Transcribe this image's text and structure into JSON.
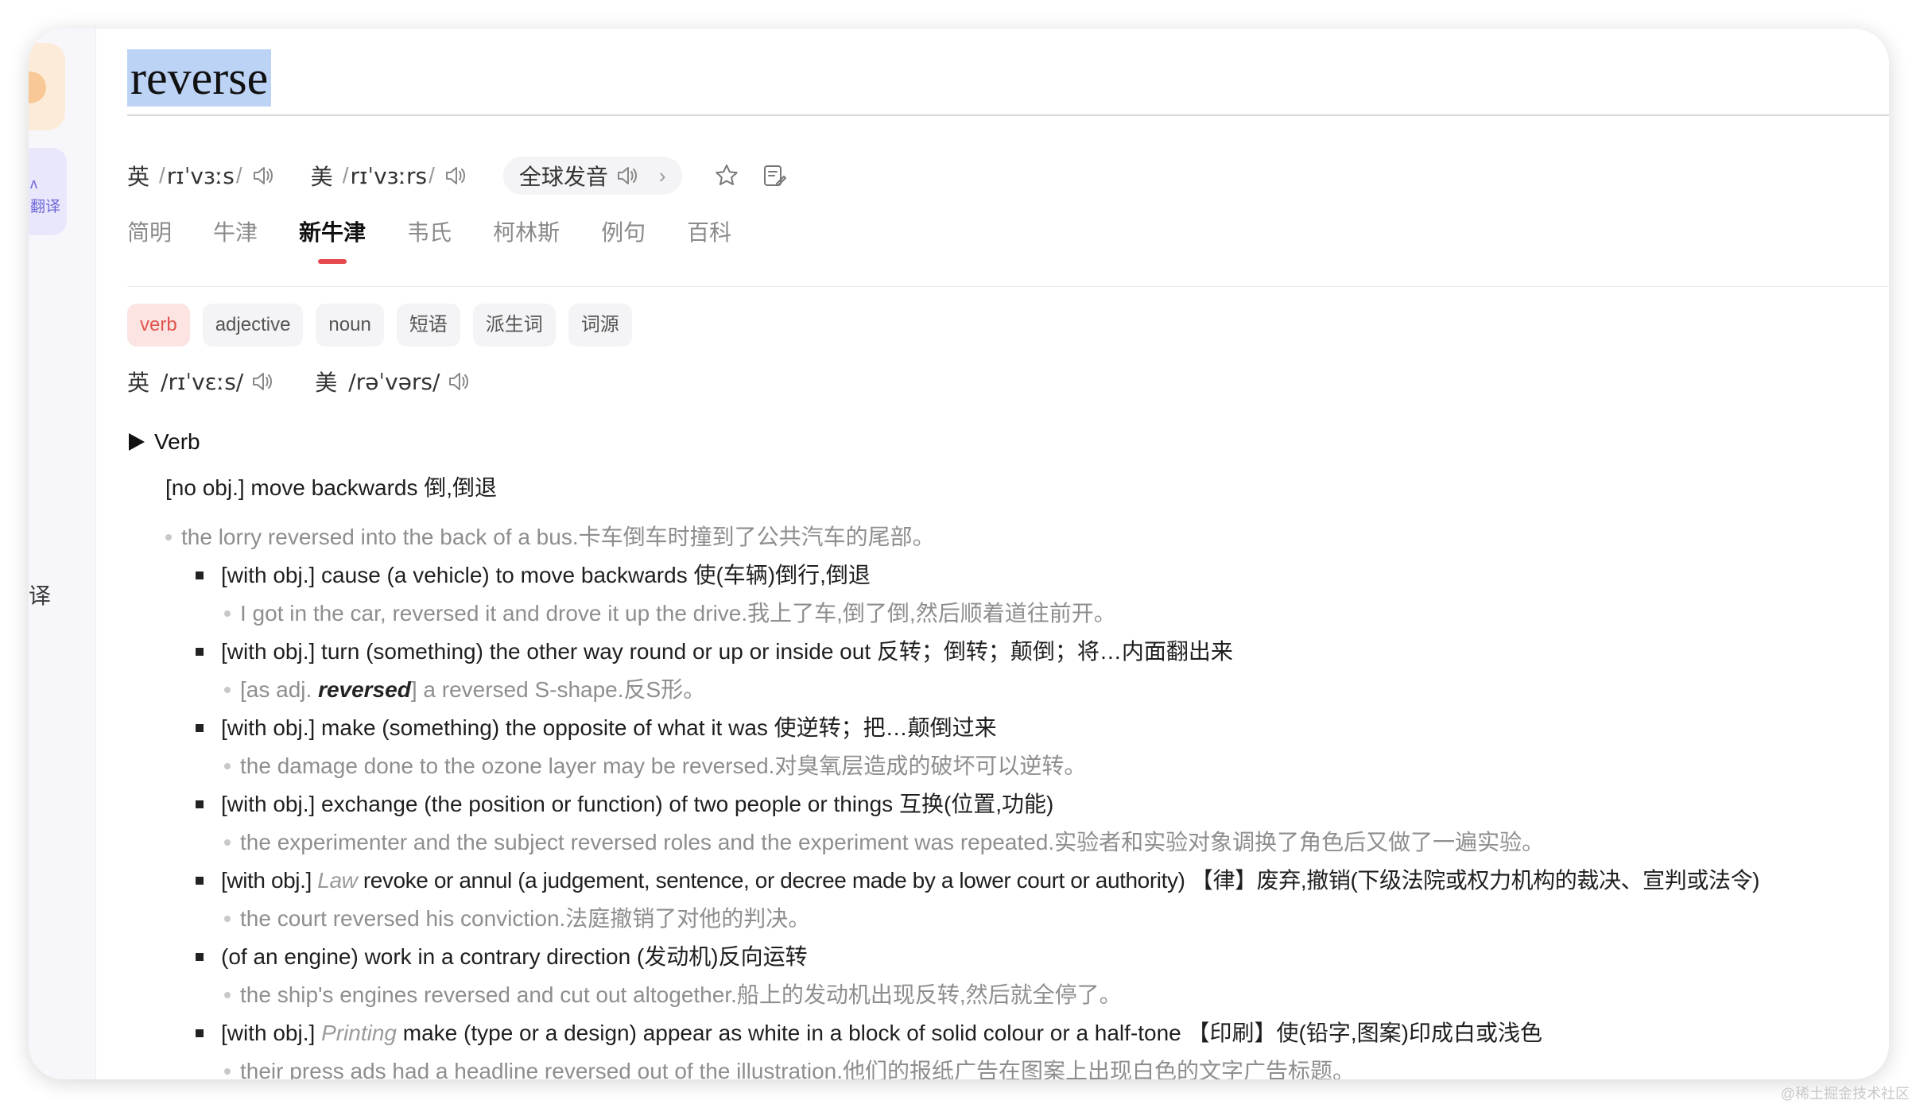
{
  "sidebar": {
    "translate_label_line1": "ʌ",
    "translate_label_line2": "翻译",
    "side_text": "译"
  },
  "word": "reverse",
  "pronunciations": [
    {
      "region": "英",
      "ipa": "rɪˈvɜːs"
    },
    {
      "region": "美",
      "ipa": "rɪˈvɜːrs"
    }
  ],
  "global_pron": {
    "label": "全球发音",
    "chevron": "›"
  },
  "icons": {
    "speaker": "speaker-icon",
    "star": "star-icon",
    "note": "note-edit-icon"
  },
  "tabs": [
    {
      "label": "简明",
      "active": false
    },
    {
      "label": "牛津",
      "active": false
    },
    {
      "label": "新牛津",
      "active": true
    },
    {
      "label": "韦氏",
      "active": false
    },
    {
      "label": "柯林斯",
      "active": false
    },
    {
      "label": "例句",
      "active": false
    },
    {
      "label": "百科",
      "active": false
    }
  ],
  "pos_filters": [
    {
      "label": "verb",
      "active": true
    },
    {
      "label": "adjective",
      "active": false
    },
    {
      "label": "noun",
      "active": false
    },
    {
      "label": "短语",
      "active": false
    },
    {
      "label": "派生词",
      "active": false
    },
    {
      "label": "词源",
      "active": false
    }
  ],
  "pron2": [
    {
      "region": "英",
      "ipa": "/rɪˈvɛːs/"
    },
    {
      "region": "美",
      "ipa": "/rəˈvərs/"
    }
  ],
  "section": "Verb",
  "first_sense": {
    "def": "[no obj.] move backwards 倒,倒退",
    "example": "the lorry reversed into the back of a bus.卡车倒车时撞到了公共汽车的尾部。"
  },
  "senses": [
    {
      "pre": "[with obj.] cause (a vehicle) to move backwards 使(车辆)倒行,倒退",
      "example": "I got in the car, reversed it and drove it up the drive.我上了车,倒了倒,然后顺着道往前开。"
    },
    {
      "pre": "[with obj.] turn (something) the other way round or up or inside out 反转；倒转；颠倒；将…内面翻出来",
      "example_pre": "[as adj. ",
      "example_bold": "reversed",
      "example_post": "] a reversed S-shape.反S形。"
    },
    {
      "pre": "[with obj.] make (something) the opposite of what it was 使逆转；把…颠倒过来",
      "example": "the damage done to the ozone layer may be reversed.对臭氧层造成的破坏可以逆转。"
    },
    {
      "pre": "[with obj.] exchange (the position or function) of two people or things 互换(位置,功能)",
      "example": "the experimenter and the subject reversed roles and the experiment was repeated.实验者和实验对象调换了角色后又做了一遍实验。"
    },
    {
      "pre": "[with obj.] ",
      "italic": "Law",
      "post": " revoke or annul (a judgement, sentence, or decree made by a lower court or authority) 【律】废弃,撤销(下级法院或权力机构的裁决、宣判或法令)",
      "example": "the court reversed his conviction.法庭撤销了对他的判决。"
    },
    {
      "pre": "(of an engine) work in a contrary direction (发动机)反向运转",
      "example": "the ship's engines reversed and cut out altogether.船上的发动机出现反转,然后就全停了。"
    },
    {
      "pre": "[with obj.] ",
      "italic": "Printing",
      "post": " make (type or a design) appear as white in a block of solid colour or a half-tone 【印刷】使(铅字,图案)印成白或浅色",
      "example": "their press ads had a headline reversed out of the illustration.他们的报纸广告在图案上出现白色的文字广告标题。"
    }
  ],
  "watermark": "@稀土掘金技术社区"
}
